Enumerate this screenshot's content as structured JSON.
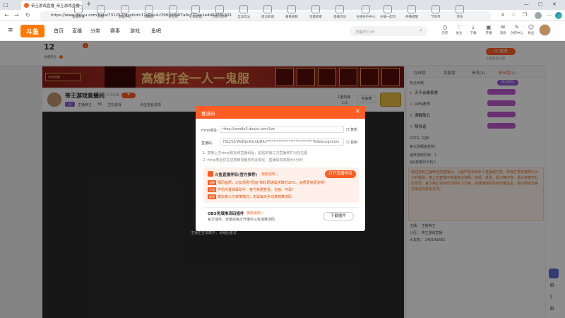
{
  "browser": {
    "tab_title": "帝王游戏直播_帝王游戏直播_主播",
    "url": "https://www.douyu.com/beta/731252?dyshid=11d0dc4-f29f0bc89f7a9c771ee1e4d00081601",
    "new_tab": "+"
  },
  "site": {
    "logo": "斗鱼",
    "nav": [
      "首页",
      "直播",
      "分类",
      "赛事",
      "游戏",
      "鱼吧"
    ],
    "search_placeholder": "灵能的小孙",
    "header_icons": [
      {
        "label": "历史",
        "icon": "history-icon"
      },
      {
        "label": "关注",
        "icon": "heart-icon"
      },
      {
        "label": "下载",
        "icon": "download-icon"
      },
      {
        "label": "开播",
        "icon": "camera-icon"
      },
      {
        "label": "消息",
        "icon": "mail-icon"
      },
      {
        "label": "创作中心",
        "icon": "edit-icon"
      },
      {
        "label": "粉丝",
        "icon": "user-icon"
      }
    ]
  },
  "level": {
    "number": "12",
    "label": "主播积分"
  },
  "categories": [
    "直播开关",
    "月榜",
    "数据中心",
    "弹幕姬",
    "分区榜",
    "礼物收益",
    "万物小助手",
    "互动玩法",
    "周边商城",
    "看看视频",
    "话题管家",
    "直播活动",
    "主播任务中心",
    "主播一起玩",
    "开播提醒",
    "节目单",
    "更多"
  ],
  "pc_badge": "PC直播",
  "pc_sub": "斗鱼首页上线",
  "banner": {
    "title": "高爆打金一人一鬼服",
    "vip": "VIP888"
  },
  "room": {
    "name": "帝王游戏直播间",
    "id": "213236",
    "level_tag": "LV",
    "streamer": "主播帝王",
    "hot": "86",
    "host_label": "主机游戏",
    "extra": "点击查看详情",
    "rank_label": "1重热榜",
    "page": "1/3",
    "site_btn": "全站榜"
  },
  "modal": {
    "title": "推流码",
    "rtmp_label": "rtmp地址:",
    "rtmp_value": "rtmp://sendtx3.douyu.com/live",
    "code_label": "直播码:",
    "code_value": "731252rWdDpnNlv/dyRKv****************************&fbrecognition",
    "copy": "复制",
    "tip1": "1. 复制上方rtmp地址和直播码后，粘贴到第三方直播软件对应位置",
    "tip2": "2. rtmp地址仅在切换推流服务时会变化；直播码有效期为5分钟",
    "promo_title": "斗鱼直播伴侣(官方推荐)",
    "promo_link": "使用说明 ›",
    "open_btn": "打开直播伴侣",
    "items": [
      {
        "tag": "流畅",
        "text": "相同画质，水友观看\"原画\"和松网速需求降低20%，画质更高更流畅！"
      },
      {
        "tag": "互动",
        "text": "伴侣内置弹幕助手、官方数据查看、全面、可靠！"
      },
      {
        "tag": "推荐",
        "text": "模拟第三方转推模式，无需每天手动复制推流码"
      }
    ],
    "obs_title": "OBS免填推流码插件",
    "obs_link": "使用说明 ›",
    "obs_desc": "官方插件，安装后每次开播可以免填推流码",
    "download_btn": "下载插件"
  },
  "below": "主播正在加载中，请稍后重试",
  "right": {
    "tabs": [
      "在线榜",
      "贡献榜",
      "贵宾(4)",
      "粉丝团(4)"
    ],
    "ranking_title": "粉丝荣耀",
    "fans_label": "成为粉丝",
    "ranks": [
      {
        "n": "1",
        "name": "天不会覆着晚"
      },
      {
        "n": "2",
        "name": "DPS老师"
      },
      {
        "n": "3",
        "name": "满醒敬云"
      },
      {
        "n": "4",
        "name": "帮修者"
      }
    ],
    "chats": [
      "CSTG: 兑换!",
      "第大骑靓富首骑：",
      "酒杯游刺洞宾：1",
      "翁9弟春风卡机人"
    ],
    "notice": "欢迎来到主播帝王的直播间。斗鱼严禁未成年人直播或打赏，所有打赏将按照124小时删除，禁止在直播中传播违法违规、色情、低俗、暴力等内容。请大家遵守社区规范。官方禁止任何形式的私下交易，请谨慎辨别任何诈骗信息，请勿相信非官方渠道的联系方式。",
    "streamer_label": "主播：",
    "streamer_name": "主播帝王",
    "section_label": "分区：",
    "section_name": "帝王游戏直播",
    "fans_count_label": "水友数：",
    "fans_count": "149143682"
  },
  "colors": {
    "brand": "#ff5d23",
    "overlay": "#000000"
  }
}
